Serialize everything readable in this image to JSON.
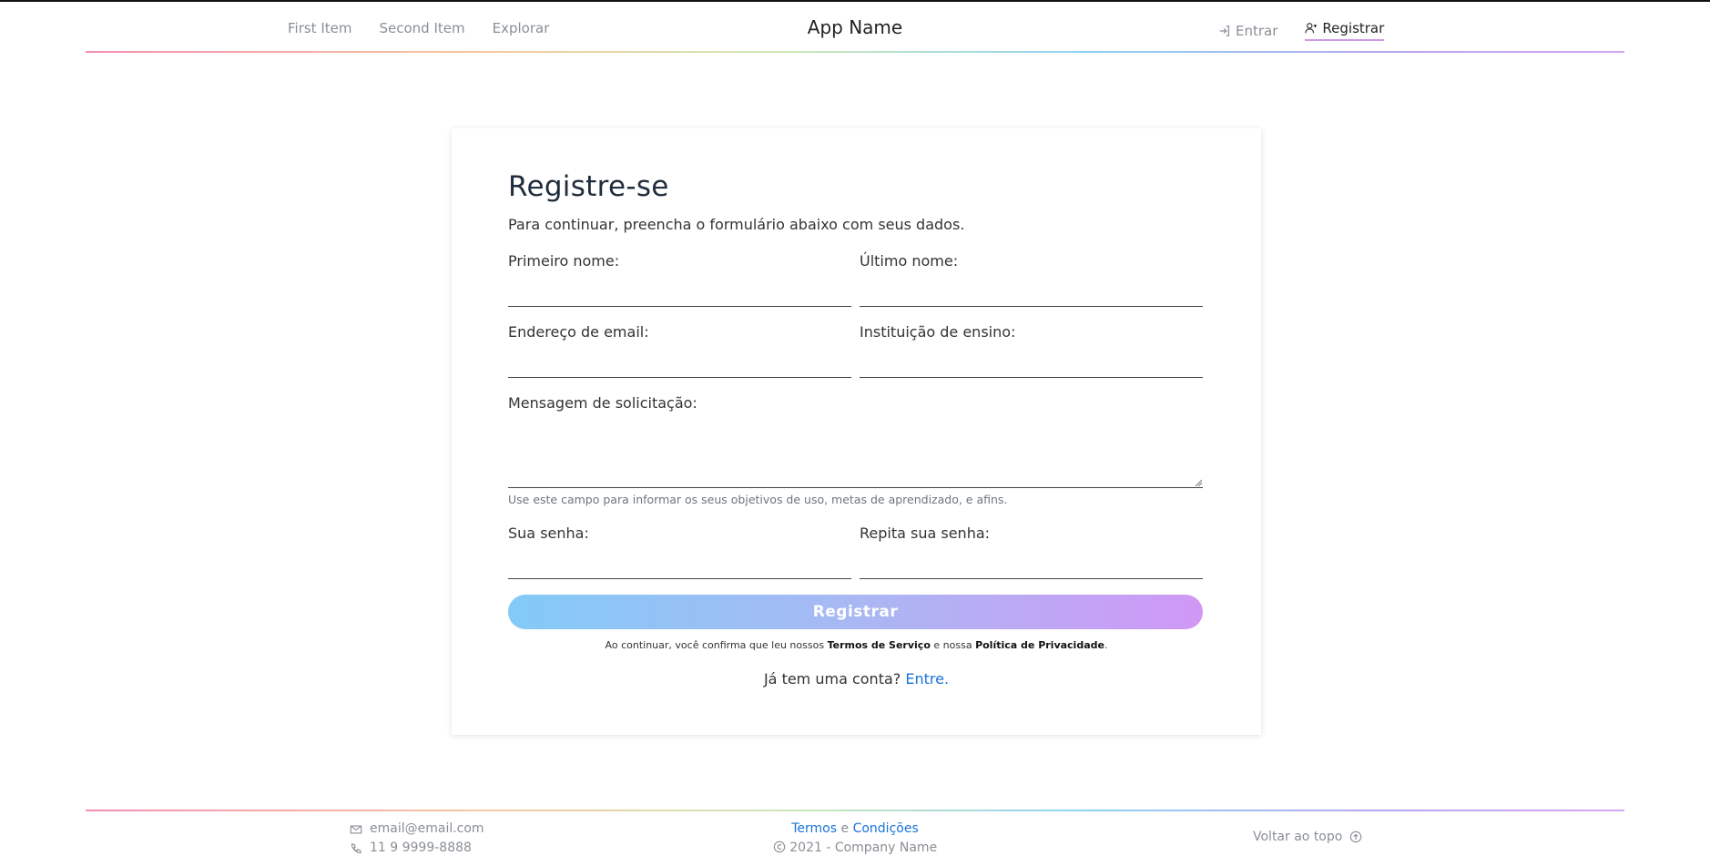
{
  "header": {
    "nav_left": [
      "First Item",
      "Second Item",
      "Explorar"
    ],
    "brand": "App Name",
    "login_label": "Entrar",
    "register_label": "Registrar"
  },
  "form": {
    "title": "Registre-se",
    "subtitle": "Para continuar, preencha o formulário abaixo com seus dados.",
    "first_name_label": "Primeiro nome:",
    "last_name_label": "Último nome:",
    "email_label": "Endereço de email:",
    "institution_label": "Instituição de ensino:",
    "message_label": "Mensagem de solicitação:",
    "message_hint": "Use este campo para informar os seus objetivos de uso, metas de aprendizado, e afins.",
    "password_label": "Sua senha:",
    "password_repeat_label": "Repita sua senha:",
    "submit_label": "Registrar",
    "legal_prefix": "Ao continuar, você confirma que leu nossos",
    "legal_terms": "Termos de Serviço",
    "legal_and": "e nossa",
    "legal_privacy": "Política de Privacidade",
    "legal_end": ".",
    "have_account": "Já tem uma conta?",
    "login_link": "Entre."
  },
  "footer": {
    "email": "email@email.com",
    "phone": "11 9 9999-8888",
    "terms_link": "Termos",
    "and": "e",
    "conditions_link": "Condições",
    "copyright": "2021 - Company Name",
    "back_to_top": "Voltar ao topo"
  },
  "colors": {
    "accent_link": "#1a73d9",
    "button_gradient_start": "#82caf7",
    "button_gradient_end": "#d098f6"
  }
}
